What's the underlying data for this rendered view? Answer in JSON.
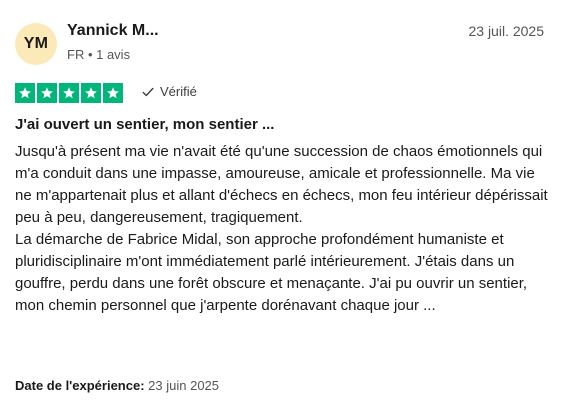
{
  "reviewer": {
    "initials": "YM",
    "name": "Yannick M...",
    "meta": "FR • 1 avis",
    "avatar_color": "#fce9b8"
  },
  "review": {
    "date": "23 juil. 2025",
    "rating": 5,
    "rating_max": 5,
    "star_color": "#00b67a",
    "verified_label": "Vérifié",
    "title": "J'ai ouvert un sentier, mon sentier ...",
    "body": "Jusqu'à présent ma vie n'avait été qu'une succession de chaos émotionnels qui m'a conduit dans une impasse, amoureuse, amicale et professionnelle. Ma vie ne m'appartenait plus et allant d'échecs en échecs, mon feu intérieur dépérissait peu à peu, dangereusement, tragiquement.\nLa démarche de Fabrice Midal, son approche profondément humaniste et pluridisciplinaire m'ont immédiatement parlé intérieurement. J'étais dans un gouffre, perdu dans une forêt obscure et menaçante. J'ai pu ouvrir un sentier, mon chemin personnel que j'arpente dorénavant chaque jour ...",
    "experience_label": "Date de l'expérience:",
    "experience_date": "23 juin 2025"
  },
  "icons": {
    "star": "star-icon",
    "verified": "checkmark-icon"
  }
}
